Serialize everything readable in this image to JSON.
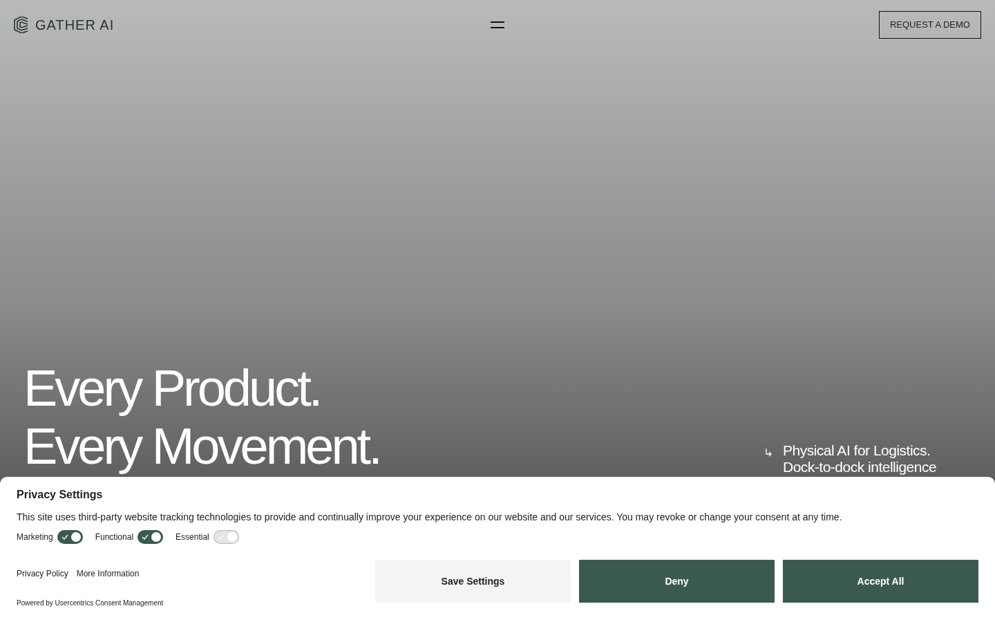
{
  "header": {
    "logo": "GATHER AI",
    "cta": "REQUEST A DEMO"
  },
  "hero": {
    "headline": [
      "Every Product.",
      "Every Movement."
    ],
    "subtitle": [
      "Physical AI for Logistics.",
      "Dock-to-dock intelligence"
    ]
  },
  "consent": {
    "title": "Privacy Settings",
    "text": "This site uses third-party website tracking technologies to provide and continually improve your experience on our website and our services. You may revoke or change your consent at any time.",
    "toggles": [
      {
        "label": "Marketing",
        "checked": true,
        "disabled": false
      },
      {
        "label": "Functional",
        "checked": true,
        "disabled": false
      },
      {
        "label": "Essential",
        "checked": true,
        "disabled": true
      }
    ],
    "links": [
      "Privacy Policy",
      "More Information"
    ],
    "powered_by": "Powered by Usercentrics Consent Management",
    "buttons": [
      {
        "label": "Save Settings",
        "kind": "secondary"
      },
      {
        "label": "Deny",
        "kind": "primary"
      },
      {
        "label": "Accept All",
        "kind": "primary"
      }
    ]
  }
}
